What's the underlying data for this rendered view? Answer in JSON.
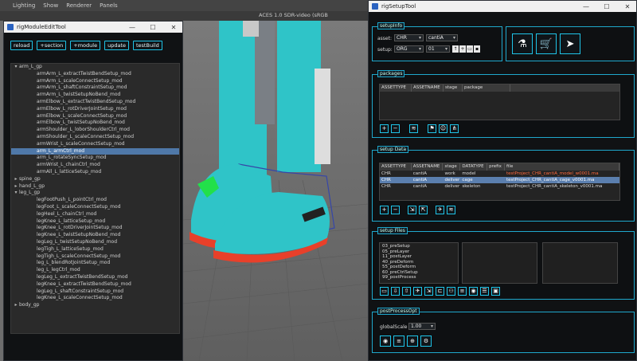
{
  "maya": {
    "menus": [
      "Lighting",
      "Show",
      "Renderer",
      "Panels"
    ],
    "colorspace": "ACES 1.0 SDR-video (sRGB"
  },
  "left": {
    "title": "rigModuleEditTool",
    "buttons": [
      "reload",
      "+section",
      "+module",
      "update",
      "testBuild"
    ],
    "tree": [
      {
        "label": "arm_L_gp",
        "level": 0,
        "arrow": "▾"
      },
      {
        "label": "armArm_L_extractTwistBendSetup_mod",
        "level": 2
      },
      {
        "label": "armArm_L_scaleConnectSetup_mod",
        "level": 2
      },
      {
        "label": "armArm_L_shaftConstraintSetup_mod",
        "level": 2
      },
      {
        "label": "armArm_L_twistSetupNoBend_mod",
        "level": 2
      },
      {
        "label": "armElbow_L_extractTwistBendSetup_mod",
        "level": 2
      },
      {
        "label": "armElbow_L_rotDriverJointSetup_mod",
        "level": 2
      },
      {
        "label": "armElbow_L_scaleConnectSetup_mod",
        "level": 2
      },
      {
        "label": "armElbow_L_twistSetupNoBend_mod",
        "level": 2
      },
      {
        "label": "armShoulder_L_loborShoulderCtrl_mod",
        "level": 2
      },
      {
        "label": "armShoulder_L_scaleConnectSetup_mod",
        "level": 2
      },
      {
        "label": "armWrist_L_scaleConnectSetup_mod",
        "level": 2
      },
      {
        "label": "arm_L_armCtrl_mod",
        "level": 2,
        "sel": true
      },
      {
        "label": "arm_L_rotateSyncSetup_mod",
        "level": 2
      },
      {
        "label": "armWrist_L_chainCtrl_mod",
        "level": 2
      },
      {
        "label": "armAll_L_latticeSetup_mod",
        "level": 2
      },
      {
        "label": "spine_gp",
        "level": 0,
        "arrow": "▸"
      },
      {
        "label": "hand_L_gp",
        "level": 0,
        "arrow": "▸"
      },
      {
        "label": "leg_L_gp",
        "level": 0,
        "arrow": "▾"
      },
      {
        "label": "legFootPush_L_pointCtrl_mod",
        "level": 2
      },
      {
        "label": "legFoot_L_scaleConnectSetup_mod",
        "level": 2
      },
      {
        "label": "legHeel_L_chainCtrl_mod",
        "level": 2
      },
      {
        "label": "legKnee_L_latticeSetup_mod",
        "level": 2
      },
      {
        "label": "legKnee_L_rotDriverJointSetup_mod",
        "level": 2
      },
      {
        "label": "legKnee_L_twistSetupNoBend_mod",
        "level": 2
      },
      {
        "label": "legLeg_L_twistSetupNoBend_mod",
        "level": 2
      },
      {
        "label": "legTigh_L_latticeSetup_mod",
        "level": 2
      },
      {
        "label": "legTigh_L_scaleConnectSetup_mod",
        "level": 2
      },
      {
        "label": "leg_L_blendRotJointSetup_mod",
        "level": 2
      },
      {
        "label": "leg_L_legCtrl_mod",
        "level": 2
      },
      {
        "label": "legLeg_L_extractTwistBendSetup_mod",
        "level": 2
      },
      {
        "label": "legKnee_L_extractTwistBendSetup_mod",
        "level": 2
      },
      {
        "label": "legLeg_L_shaftConstraintSetup_mod",
        "level": 2
      },
      {
        "label": "legKnee_L_scaleConnectSetup_mod",
        "level": 2
      },
      {
        "label": "body_gp",
        "level": 0,
        "arrow": "▸"
      }
    ]
  },
  "right": {
    "title": "rigSetupTool",
    "setupinfo": {
      "title": "setupInfo",
      "asset_label": "asset:",
      "asset_type": "CHR",
      "asset_name": "cantiA",
      "setup_label": "setup:",
      "setup_stage": "ORG",
      "setup_ver": "01"
    },
    "packages": {
      "title": "packages",
      "headers": [
        "ASSETTYPE",
        "ASSETNAME",
        "stage",
        "package"
      ]
    },
    "setupdata": {
      "title": "setup Data",
      "headers": [
        "ASSETTYPE",
        "ASSETNAME",
        "stage",
        "DATATYPE",
        "prefix",
        "file"
      ],
      "rows": [
        {
          "type": "CHR",
          "name": "cantiA",
          "stage": "work",
          "dtype": "model",
          "prefix": "",
          "file": "testProject_CHR_cantiA_model_w0001.ma",
          "hl": true
        },
        {
          "type": "CHR",
          "name": "cantiA",
          "stage": "deliver",
          "dtype": "cage",
          "prefix": "",
          "file": "testProject_CHR_cantiA_cage_v0001.ma",
          "sel": true
        },
        {
          "type": "CHR",
          "name": "cantiA",
          "stage": "deliver",
          "dtype": "skeleton",
          "prefix": "",
          "file": "testProject_CHR_cantiA_skeleton_v0001.ma"
        }
      ]
    },
    "setupfiles": {
      "title": "setup Files",
      "items": [
        "03_preSetup",
        "05_preLayer",
        "11_postLayer",
        "40_preDeform",
        "55_postDeform",
        "60_preCtrlSetup",
        "99_postProcess"
      ]
    },
    "postprocess": {
      "title": "postProcessOpt",
      "scale_label": "globalScale",
      "scale_value": "1.00"
    }
  },
  "colors": {
    "accent": "#1fc4e8",
    "filehl": "#ff6a3d",
    "selection": "#4f78a8",
    "panel": "#101214",
    "viewport": "#6f6f6f",
    "character": "#2ec2c6"
  }
}
